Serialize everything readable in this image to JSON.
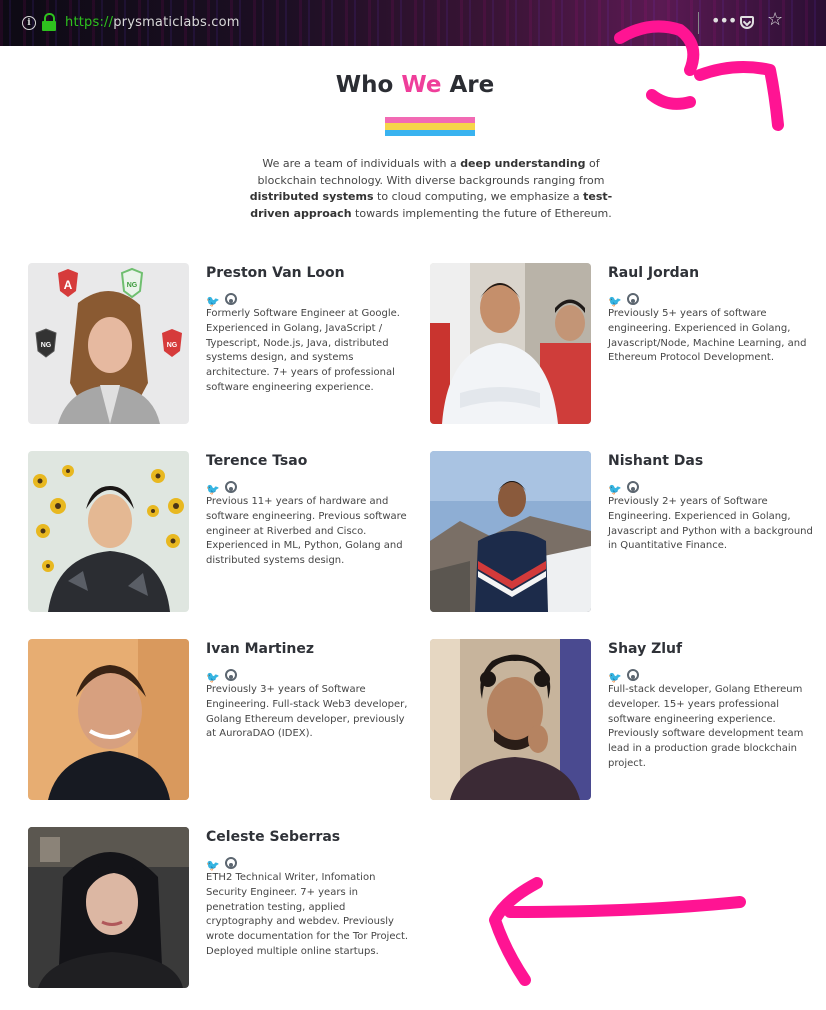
{
  "browser": {
    "url_scheme": "https://",
    "url_host": "prysmaticlabs.com",
    "icons": [
      "info-icon",
      "lock-icon",
      "more-dots-icon",
      "pocket-icon",
      "bookmark-star-icon"
    ]
  },
  "section": {
    "title_before": "Who ",
    "title_accent": "We",
    "title_after": " Are",
    "accent_color": "#ef3e9a",
    "flag_colors": [
      "#f26ab4",
      "#f6d54a",
      "#39b3f0"
    ],
    "intro": {
      "p1": "We are a team of individuals with a ",
      "b1": "deep understanding",
      "p2": " of blockchain technology. With diverse backgrounds ranging from ",
      "b2": "distributed systems",
      "p3": " to cloud computing, we emphasize a ",
      "b3": "test-driven approach",
      "p4": " towards implementing the future of Ethereum."
    }
  },
  "team": [
    {
      "name": "Preston Van Loon",
      "bio": "Formerly Software Engineer at Google. Experienced in Golang, JavaScript / Typescript, Node.js, Java, distributed systems design, and systems architecture. 7+ years of professional software engineering experience.",
      "photo_badges": [
        "A",
        "NG",
        "NG",
        "NG"
      ]
    },
    {
      "name": "Raul Jordan",
      "bio": "Previously 5+ years of software engineering. Experienced in Golang, Javascript/Node, Machine Learning, and Ethereum Protocol Development."
    },
    {
      "name": "Terence Tsao",
      "bio": "Previous 11+ years of hardware and software engineering. Previous software engineer at Riverbed and Cisco. Experienced in ML, Python, Golang and distributed systems design."
    },
    {
      "name": "Nishant Das",
      "bio": "Previously 2+ years of Software Engineering. Experienced in Golang, Javascript and Python with a background in Quantitative Finance."
    },
    {
      "name": "Ivan Martinez",
      "bio": "Previously 3+ years of Software Engineering. Full-stack Web3 developer, Golang Ethereum developer, previously at AuroraDAO (IDEX)."
    },
    {
      "name": "Shay Zluf",
      "bio": "Full-stack developer, Golang Ethereum developer. 15+ years professional software engineering experience. Previously software development team lead in a production grade blockchain project."
    },
    {
      "name": "Celeste Seberras",
      "bio": "ETH2 Technical Writer, Infomation Security Engineer. 7+ years in penetration testing, applied cryptography and webdev. Previously wrote documentation for the Tor Project. Deployed multiple online startups."
    }
  ],
  "annotation_color": "#ff1493"
}
